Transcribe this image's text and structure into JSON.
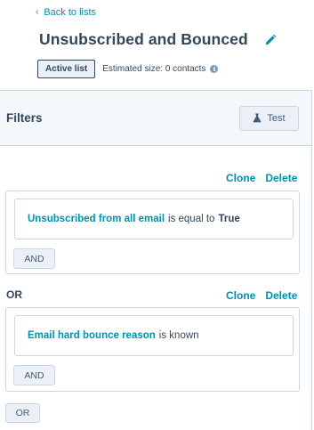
{
  "nav": {
    "back_label": "Back to lists"
  },
  "header": {
    "title": "Unsubscribed and Bounced",
    "badge": "Active list",
    "estimated_size": "Estimated size: 0 contacts"
  },
  "filters": {
    "title": "Filters",
    "test_label": "Test",
    "groups": [
      {
        "clone_label": "Clone",
        "delete_label": "Delete",
        "condition": {
          "property": "Unsubscribed from all email",
          "operator": "is equal to",
          "value": "True"
        },
        "and_label": "AND"
      },
      {
        "connector": "OR",
        "clone_label": "Clone",
        "delete_label": "Delete",
        "condition": {
          "property": "Email hard bounce reason",
          "operator": "is known",
          "value": ""
        },
        "and_label": "AND"
      }
    ],
    "or_label": "OR"
  },
  "colors": {
    "link": "#0091ae",
    "text": "#33475b",
    "border": "#cbd6e2",
    "button_bg": "#eaf0f6",
    "panel_bg": "#f5f8fa"
  }
}
